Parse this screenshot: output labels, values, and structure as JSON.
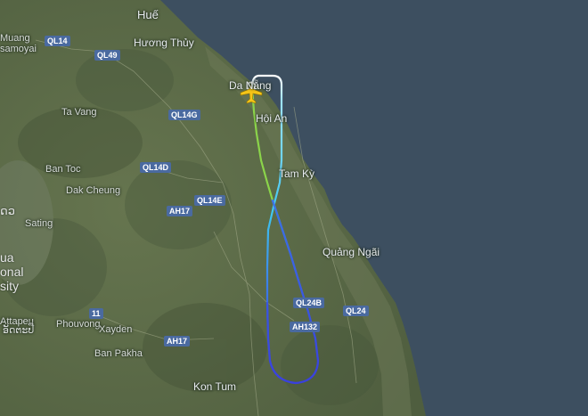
{
  "map": {
    "places": [
      {
        "id": "hue",
        "text": "Huế"
      },
      {
        "id": "huong-thuy",
        "text": "Hương Thủy"
      },
      {
        "id": "da-nang",
        "text": "Da Nẵng"
      },
      {
        "id": "hoi-an",
        "text": "Hội An"
      },
      {
        "id": "ta-vang",
        "text": "Ta Vang"
      },
      {
        "id": "ban-toc",
        "text": "Ban Toc"
      },
      {
        "id": "dak-cheung",
        "text": "Dak Cheung"
      },
      {
        "id": "tam-ky",
        "text": "Tam Kỳ"
      },
      {
        "id": "sating",
        "text": "Sating"
      },
      {
        "id": "phouvong",
        "text": "Phouvong"
      },
      {
        "id": "quang-ngai",
        "text": "Quảng Ngãi"
      },
      {
        "id": "attapeu",
        "text": "Attapeu"
      },
      {
        "id": "attapeu-lao",
        "text": "ອັດຕະປື"
      },
      {
        "id": "xayden",
        "text": "Xayden"
      },
      {
        "id": "ban-pakha",
        "text": "Ban Pakha"
      },
      {
        "id": "kon-tum",
        "text": "Kon Tum"
      },
      {
        "id": "muang",
        "text": "Muang"
      },
      {
        "id": "samoyai",
        "text": "samoyai"
      }
    ],
    "edge_text": [
      {
        "id": "edge-ua",
        "text": "ua"
      },
      {
        "id": "edge-onal",
        "text": "onal"
      },
      {
        "id": "edge-sity",
        "text": "sity"
      },
      {
        "id": "edge-lao",
        "text": "ດວ"
      }
    ],
    "roads": [
      {
        "id": "ql14-north",
        "text": "QL14"
      },
      {
        "id": "ql49",
        "text": "QL49"
      },
      {
        "id": "ql14g",
        "text": "QL14G"
      },
      {
        "id": "ql14d",
        "text": "QL14D"
      },
      {
        "id": "ql14e",
        "text": "QL14E"
      },
      {
        "id": "ah17-north",
        "text": "AH17"
      },
      {
        "id": "ql24b",
        "text": "QL24B"
      },
      {
        "id": "ql24",
        "text": "QL24"
      },
      {
        "id": "ah132",
        "text": "AH132"
      },
      {
        "id": "route-11",
        "text": "11"
      },
      {
        "id": "ah17-south",
        "text": "AH17"
      }
    ],
    "colors": {
      "sea": "#3d4f60",
      "land": "#5b6b4a",
      "road_shield": "#4a6aa0",
      "aircraft": "#f5c518",
      "track_start": "#ffffff",
      "track_mid": "#3fc6f0",
      "track_end": "#3a2bd8",
      "track_green": "#8bd44a"
    },
    "aircraft_icon": "airplane-icon"
  }
}
